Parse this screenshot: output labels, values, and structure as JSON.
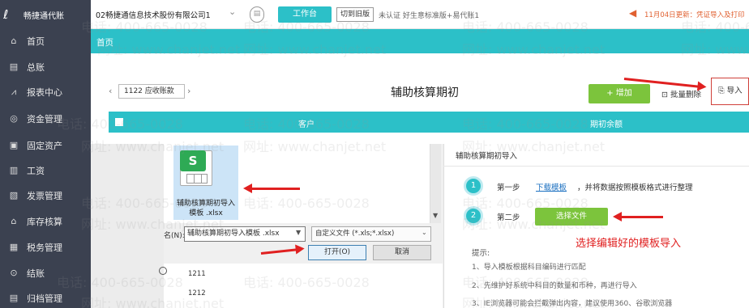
{
  "app": {
    "logo_text": "畅捷通代账"
  },
  "sidebar": {
    "items": [
      {
        "label": "首页",
        "icon": "home-icon",
        "glyph": "⌂"
      },
      {
        "label": "总账",
        "icon": "ledger-icon",
        "glyph": "▤"
      },
      {
        "label": "报表中心",
        "icon": "chart-icon",
        "glyph": "⩘"
      },
      {
        "label": "资金管理",
        "icon": "money-icon",
        "glyph": "◎"
      },
      {
        "label": "固定资产",
        "icon": "asset-icon",
        "glyph": "▣"
      },
      {
        "label": "工资",
        "icon": "salary-icon",
        "glyph": "▥"
      },
      {
        "label": "发票管理",
        "icon": "invoice-icon",
        "glyph": "▧"
      },
      {
        "label": "库存核算",
        "icon": "inventory-icon",
        "glyph": "⌂"
      },
      {
        "label": "税务管理",
        "icon": "tax-icon",
        "glyph": "▦"
      },
      {
        "label": "结账",
        "icon": "checkout-icon",
        "glyph": "⊙"
      },
      {
        "label": "归档管理",
        "icon": "archive-icon",
        "glyph": "▤"
      }
    ]
  },
  "topbar": {
    "company": "02畅捷通信息技术股份有限公司1",
    "workbench": "工作台",
    "old_version": "切到旧版",
    "cert": "未认证  好生意标准版+易代账1",
    "notice": "11月04日更新：凭证导入及打印"
  },
  "tabs": {
    "home": "首页"
  },
  "main": {
    "account": "1122  应收账款",
    "title": "辅助核算期初",
    "add": "+ 增加",
    "bulk_delete": "批量删除",
    "import": "导入",
    "col_customer": "客户",
    "col_balance": "期初余额"
  },
  "file_dialog": {
    "file_name": "辅助核算期初导入模板 .xlsx",
    "filename_label": "名(N):",
    "filename_value": "辅助核算期初导入模板 .xlsx",
    "filetype": "自定义文件 (*.xls;*.xlsx)",
    "open": "打开(O)",
    "cancel": "取消",
    "accounts": [
      "1211",
      "1212"
    ]
  },
  "import_panel": {
    "title": "辅助核算期初导入",
    "step1_num": "1",
    "step1_label": "第一步",
    "download_link": "下载模板",
    "step1_text": "，并将数据按照模板格式进行整理",
    "step2_num": "2",
    "step2_label": "第二步",
    "choose_file": "选择文件",
    "annotation": "选择编辑好的模板导入",
    "tips_title": "提示:",
    "tips": [
      "1、导入模板根据科目编码进行匹配",
      "2、先维护好系统中科目的数量和币种，再进行导入",
      "3、IE浏览器可能会拦截弹出内容，建议使用360、谷歌浏览器"
    ]
  },
  "watermark": {
    "phone": "电话: 400-665-0028",
    "site": "网址: www.chanjet.net"
  },
  "colors": {
    "accent": "#2cc0c8",
    "sidebar": "#3b4150",
    "green": "#7cc43c",
    "annotation": "#e02020"
  }
}
